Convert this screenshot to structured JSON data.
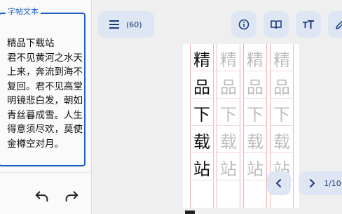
{
  "text_panel": {
    "label": "字帖文本",
    "content": "精品下载站\n君不见黄河之水天上来，奔流到海不复回。君不见高堂明镜悲白发，朝如青丝暮成雪。人生得意须尽欢，莫使金樽空对月。"
  },
  "toolbar": {
    "menu_count": "(60)",
    "icons": [
      "menu-icon",
      "info-icon",
      "book-icon",
      "font-size-icon",
      "edit-icon"
    ]
  },
  "sheet": {
    "columns": [
      {
        "style": "dark",
        "chars": [
          "精",
          "品",
          "下",
          "载",
          "站"
        ]
      },
      {
        "style": "light",
        "chars": [
          "精",
          "品",
          "下",
          "载",
          "站"
        ]
      },
      {
        "style": "light",
        "chars": [
          "精",
          "品",
          "下",
          "载",
          "站"
        ]
      },
      {
        "style": "light",
        "chars": [
          "精",
          "品",
          "下",
          "载",
          "站"
        ]
      }
    ]
  },
  "pager": {
    "page": "1/10(",
    "icons": [
      "chevron-left-icon",
      "chevron-right-icon"
    ]
  },
  "colors": {
    "accent": "#1a5fc4",
    "button_bg": "#dde6f2",
    "grid_line": "#f0b3b3",
    "trace_char": "#bdbdbd"
  }
}
